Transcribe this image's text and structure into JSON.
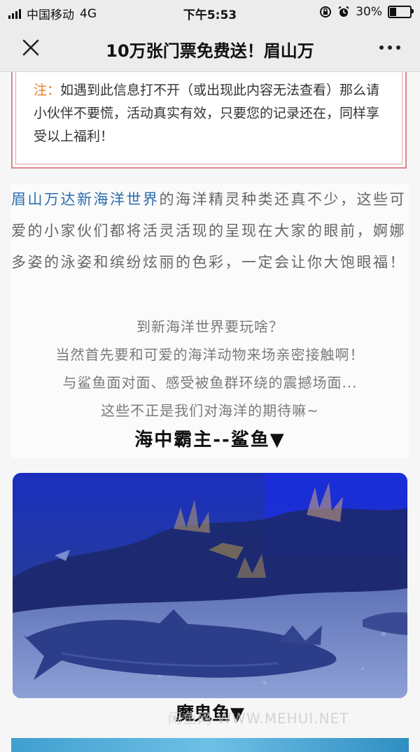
{
  "status_bar": {
    "carrier": "中国移动",
    "network": "4G",
    "time": "下午5:53",
    "battery": "30%",
    "battery_level": 0.3
  },
  "nav": {
    "title": "10万张门票免费送！眉山万"
  },
  "note": {
    "label": "注：",
    "text": "如遇到此信息打不开（或出现此内容无法查看）那么请小伙伴不要慌，活动真实有效，只要您的记录还在，同样享受以上福利！"
  },
  "article": {
    "highlight": "眉山万达新海洋世界",
    "paragraph": "的海洋精灵种类还真不少，这些可爱的小家伙们都将活灵活现的呈现在大家的眼前，婀娜多姿的泳姿和缤纷炫丽的色彩，一定会让你大饱眼福！",
    "center_lines": [
      "到新海洋世界要玩啥？",
      "当然首先要和可爱的海洋动物来场亲密接触啊！",
      "与鲨鱼面对面、感受被鱼群环绕的震撼场面...",
      "这些不正是我们对海洋的期待嘛~"
    ],
    "section_heading": "海中霸主--鲨鱼▼",
    "caption": "魔鬼鱼▼",
    "watermark": "闲鱼网 WWW.MEHUI.NET"
  },
  "colors": {
    "highlight": "#2b6cb0",
    "note_label": "#e67e22",
    "note_border": "#d9878d"
  },
  "icons": {
    "close": "close-icon",
    "more": "more-icon",
    "alarm": "alarm-icon",
    "lock": "lock-rotation-icon"
  }
}
